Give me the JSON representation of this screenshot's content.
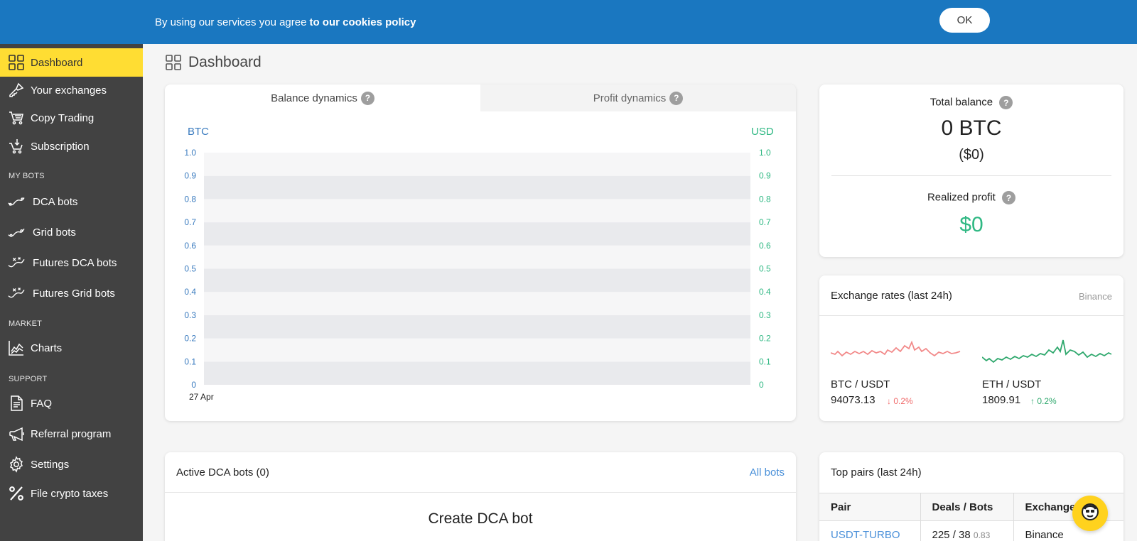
{
  "cookie": {
    "text": "By using our services you agree",
    "link": "to our cookies policy",
    "ok_label": "OK"
  },
  "sidebar": {
    "items_top": [
      {
        "label": "Dashboard",
        "icon": "grid-icon",
        "active": true
      },
      {
        "label": "Your exchanges",
        "icon": "key-icon"
      },
      {
        "label": "Copy Trading",
        "icon": "cart-icon"
      },
      {
        "label": "Subscription",
        "icon": "cart-download-icon"
      }
    ],
    "section_my_bots": "MY BOTS",
    "my_bots": [
      {
        "label": "DCA bots",
        "icon": "dca-bot-icon"
      },
      {
        "label": "Grid bots",
        "icon": "grid-bot-icon"
      },
      {
        "label": "Futures DCA bots",
        "icon": "futures-dca-icon"
      },
      {
        "label": "Futures Grid bots",
        "icon": "futures-grid-icon"
      }
    ],
    "section_market": "MARKET",
    "market": [
      {
        "label": "Charts",
        "icon": "chart-icon"
      }
    ],
    "section_support": "SUPPORT",
    "support": [
      {
        "label": "FAQ",
        "icon": "document-icon"
      },
      {
        "label": "Referral program",
        "icon": "megaphone-icon"
      },
      {
        "label": "Settings",
        "icon": "gear-icon"
      },
      {
        "label": "File crypto taxes",
        "icon": "percent-icon"
      }
    ]
  },
  "page": {
    "title": "Dashboard"
  },
  "chart_card": {
    "tabs": [
      "Balance dynamics",
      "Profit dynamics"
    ],
    "active_tab": 0,
    "help": "?"
  },
  "chart_data": {
    "type": "line",
    "x": [
      "27 Apr"
    ],
    "series": [],
    "ylabel_left": "BTC",
    "ylabel_right": "USD",
    "yticks_left": [
      "1.0",
      "0.9",
      "0.8",
      "0.7",
      "0.6",
      "0.5",
      "0.4",
      "0.3",
      "0.2",
      "0.1",
      "0"
    ],
    "yticks_right": [
      "1.0",
      "0.9",
      "0.8",
      "0.7",
      "0.6",
      "0.5",
      "0.4",
      "0.3",
      "0.2",
      "0.1",
      "0"
    ],
    "ylim": [
      0,
      1
    ],
    "grid": true,
    "colors": {
      "left_axis": "#3a7bbf",
      "right_axis": "#2fb883",
      "band": "#e9eaed",
      "band_alt": "#f6f6f7"
    }
  },
  "balance": {
    "total_label": "Total balance",
    "total_btc": "0 BTC",
    "total_usd": "($0)",
    "realized_label": "Realized profit",
    "realized_value": "$0",
    "help": "?"
  },
  "rates": {
    "title": "Exchange rates (last 24h)",
    "exchange": "Binance",
    "pairs": [
      {
        "name": "BTC / USDT",
        "price": "94073.13",
        "change": "0.2%",
        "direction": "down",
        "color": "#f06b6b"
      },
      {
        "name": "ETH / USDT",
        "price": "1809.91",
        "change": "0.2%",
        "direction": "up",
        "color": "#2fa86d"
      }
    ]
  },
  "bots": {
    "title": "Active DCA bots (0)",
    "all_link": "All bots",
    "create_label": "Create DCA bot"
  },
  "top_pairs": {
    "title": "Top pairs (last 24h)",
    "columns": [
      "Pair",
      "Deals / Bots",
      "Exchange"
    ],
    "rows": [
      {
        "pair": "USDT-TURBO",
        "deals": "225 / 38",
        "ratio": "0.83",
        "exchange": "Binance"
      }
    ]
  }
}
